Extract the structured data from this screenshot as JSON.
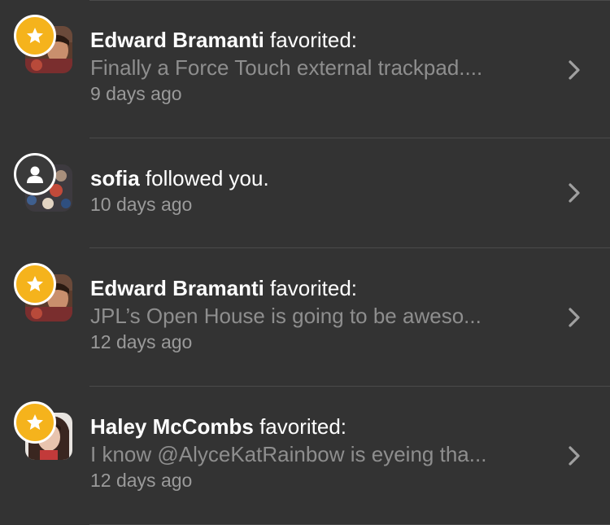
{
  "notifications": [
    {
      "name": "Edward Bramanti",
      "action": " favorited:",
      "preview": "Finally a Force Touch external trackpad....",
      "time": "9 days ago",
      "badge": "star-icon",
      "avatar": "edward"
    },
    {
      "name": "sofia",
      "action": " followed you.",
      "preview": "",
      "time": "10 days ago",
      "badge": "person-icon",
      "avatar": "sofia"
    },
    {
      "name": "Edward Bramanti",
      "action": " favorited:",
      "preview": "JPL’s Open House is going to be aweso...",
      "time": "12 days ago",
      "badge": "star-icon",
      "avatar": "edward"
    },
    {
      "name": "Haley McCombs",
      "action": " favorited:",
      "preview": "I know @AlyceKatRainbow is eyeing tha...",
      "time": "12 days ago",
      "badge": "star-icon",
      "avatar": "haley"
    }
  ],
  "colors": {
    "background": "#333333",
    "star_badge": "#f5b31c",
    "separator": "#4a4a4a",
    "primary_text": "#ffffff",
    "secondary_text": "#8e8e8e"
  }
}
